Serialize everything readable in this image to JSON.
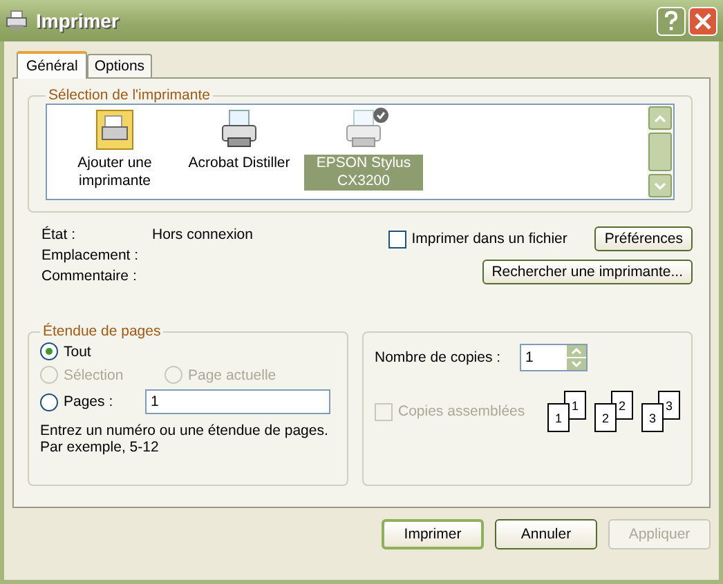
{
  "window": {
    "title": "Imprimer"
  },
  "tabs": [
    {
      "label": "Général",
      "selected": true
    },
    {
      "label": "Options",
      "selected": false
    }
  ],
  "printer_selection": {
    "title": "Sélection de l'imprimante",
    "printers": [
      {
        "kind": "add",
        "name": "Ajouter une imprimante",
        "selected": false,
        "default": false
      },
      {
        "kind": "printer",
        "name": "Acrobat Distiller",
        "selected": false,
        "default": false
      },
      {
        "kind": "printer",
        "name": "EPSON Stylus CX3200",
        "selected": true,
        "default": true
      }
    ]
  },
  "info": [
    {
      "label": "État :",
      "value": "Hors connexion"
    },
    {
      "label": "Emplacement :"
    },
    {
      "label": "Commentaire :"
    }
  ],
  "print_to_file": {
    "label": "Imprimer dans un fichier",
    "checked": false
  },
  "preferences_button": "Préférences",
  "find_printer_button": "Rechercher une imprimante...",
  "page_range": {
    "title": "Étendue de pages",
    "options": [
      {
        "label": "Tout",
        "selected": true,
        "disabled": false
      },
      {
        "label": "Sélection",
        "selected": false,
        "disabled": true
      },
      {
        "label": "Page actuelle",
        "selected": false,
        "disabled": true
      },
      {
        "label": "Pages :",
        "selected": false,
        "disabled": false
      }
    ],
    "pages_value": "1",
    "hint": [
      "Entrez un numéro ou une étendue de pages.",
      "Par exemple, 5-12"
    ]
  },
  "copies": {
    "label": "Nombre de copies :",
    "value": "1",
    "collate": {
      "label": "Copies assemblées",
      "checked": false,
      "disabled": true
    },
    "collate_pages": [
      "1",
      "1",
      "2",
      "2",
      "3",
      "3"
    ]
  },
  "buttons": [
    {
      "label": "Imprimer",
      "default": true,
      "disabled": false
    },
    {
      "label": "Annuler",
      "default": false,
      "disabled": false
    },
    {
      "label": "Appliquer",
      "default": false,
      "disabled": true
    }
  ]
}
